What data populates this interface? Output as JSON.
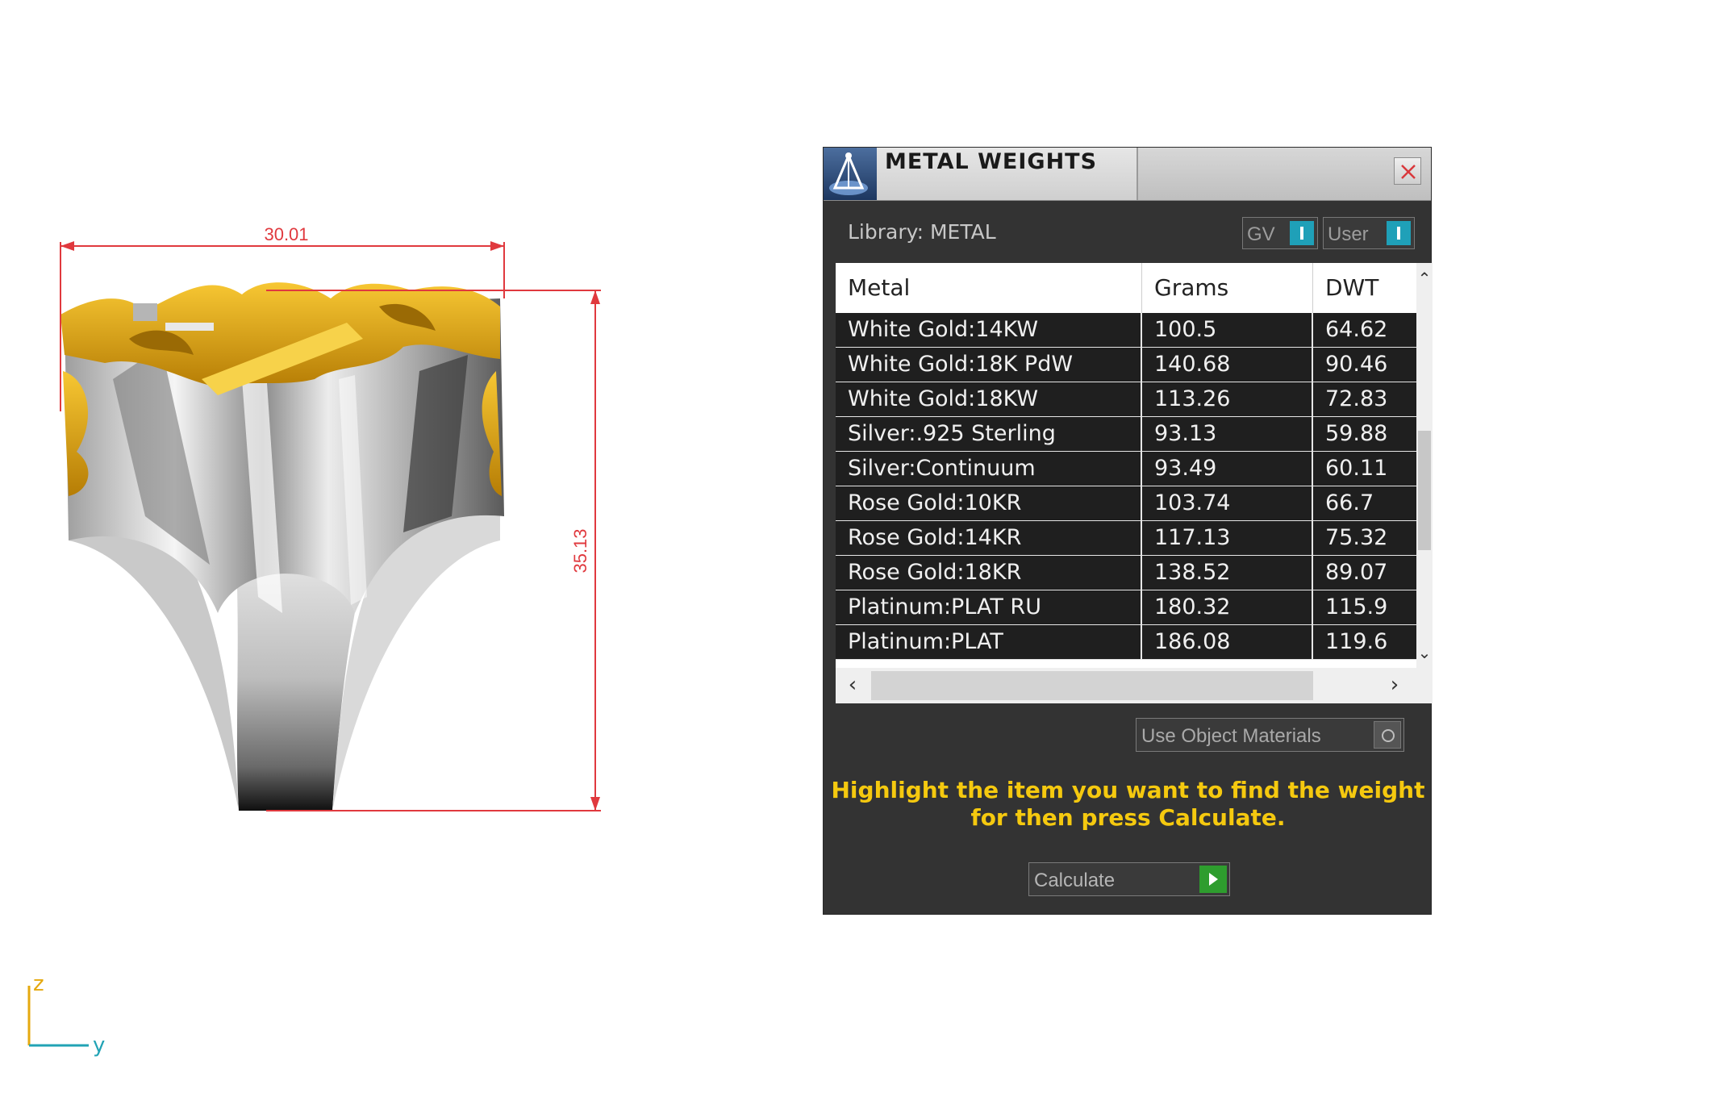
{
  "viewport": {
    "dimension_width": "30.01",
    "dimension_height": "35.13",
    "axis_z_label": "z",
    "axis_y_label": "y",
    "dimension_color": "#e0393e",
    "metal_yellow": "#e5a90f"
  },
  "panel": {
    "title": "METAL WEIGHTS",
    "close_icon": "close-icon",
    "library_label": "Library: METAL",
    "toggles": {
      "gv_label": "GV",
      "user_label": "User"
    },
    "table": {
      "headers": [
        "Metal",
        "Grams",
        "DWT"
      ],
      "rows": [
        {
          "metal": "White Gold:14KW",
          "grams": "100.5",
          "dwt": "64.62"
        },
        {
          "metal": "White Gold:18K PdW",
          "grams": "140.68",
          "dwt": "90.46"
        },
        {
          "metal": "White Gold:18KW",
          "grams": "113.26",
          "dwt": "72.83"
        },
        {
          "metal": "Silver:.925 Sterling",
          "grams": "93.13",
          "dwt": "59.88"
        },
        {
          "metal": "Silver:Continuum",
          "grams": "93.49",
          "dwt": "60.11"
        },
        {
          "metal": "Rose Gold:10KR",
          "grams": "103.74",
          "dwt": "66.7"
        },
        {
          "metal": "Rose Gold:14KR",
          "grams": "117.13",
          "dwt": "75.32"
        },
        {
          "metal": "Rose Gold:18KR",
          "grams": "138.52",
          "dwt": "89.07"
        },
        {
          "metal": "Platinum:PLAT RU",
          "grams": "180.32",
          "dwt": "115.9"
        },
        {
          "metal": "Platinum:PLAT",
          "grams": "186.08",
          "dwt": "119.6"
        }
      ]
    },
    "use_object_materials_label": "Use Object Materials",
    "hint_line1": "Highlight the item you want to find the weight",
    "hint_line2": "for then press Calculate.",
    "calculate_label": "Calculate",
    "accent_hint": "#f5c90f",
    "accent_toggle": "#1fa0b8",
    "accent_calc": "#2e9d2e"
  }
}
